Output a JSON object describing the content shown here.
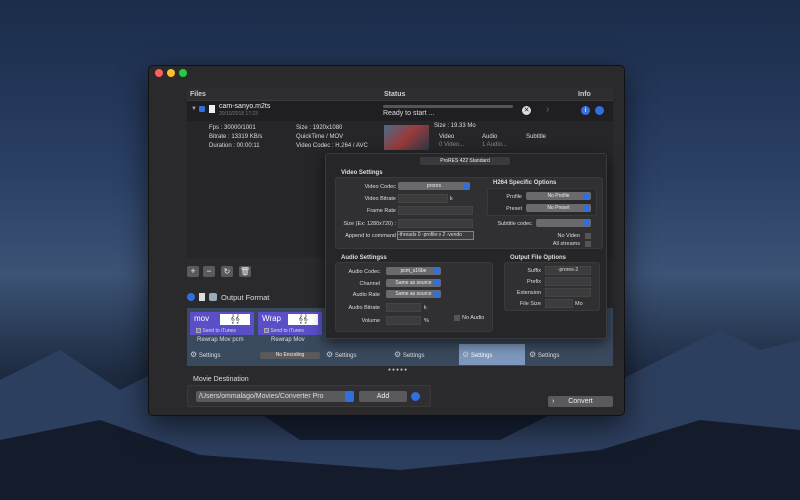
{
  "window": {
    "close_color": "#fe5f57",
    "min_color": "#febc2e",
    "max_color": "#28c840"
  },
  "files_table": {
    "headers": {
      "files": "Files",
      "status": "Status",
      "info": "Info"
    },
    "file": {
      "name": "cam-sanyo.m2ts",
      "date": "20/10/2018 17:23",
      "status": "Ready to start ...",
      "progress": 0,
      "fps": "Fps : 30000/1001",
      "bitrate": "Bitrate : 13319 KB/s",
      "duration": "Duration : 00:00:11",
      "size": "Size : 1920x1080",
      "container": "QuickTime / MOV",
      "video_codec": "Video Codec : H.264 / AVC",
      "file_size": "Size : 19.33 Mo",
      "video_label": "Video",
      "video_value": "0 Video...",
      "audio_label": "Audio",
      "audio_value": "1 Audio...",
      "subtitle_label": "Subtitle"
    }
  },
  "popover": {
    "preset": "ProRES 422 Standard",
    "video": {
      "title": "Video Settings",
      "codec_label": "Video Codec",
      "codec": "prores",
      "bitrate_label": "Video Bitrate",
      "bitrate_unit": "k",
      "framerate_label": "Frame Rate",
      "size_label": "Size (Ex: 1280x720) :",
      "append_label": "Append to command",
      "append_value": "-threads 0 -profile:v 2 -vendo"
    },
    "h264": {
      "title": "H264 Specific Options",
      "profile_label": "Profile",
      "profile": "No Profile",
      "preset_label": "Preset",
      "preset": "No Preset"
    },
    "subtitle_codec_label": "Subtitle codec",
    "no_video": "No Video",
    "all_streams": "All streams",
    "audio": {
      "title": "Audio Settingss",
      "codec_label": "Audio Codec",
      "codec": "pcm_s16be",
      "channel_label": "Channel",
      "channel": "Same as source",
      "rate_label": "Audio Rate",
      "rate": "Same as source",
      "bitrate_label": "Audio Bitrate",
      "bitrate_unit": "k",
      "volume_label": "Volume",
      "volume_unit": "%",
      "no_audio": "No Audio"
    },
    "output": {
      "title": "Output File Options",
      "suffix_label": "Suffix",
      "suffix": "-prores-2",
      "prefix_label": "Prefix",
      "extension_label": "Extension",
      "filesize_label": "File Size",
      "filesize_unit": "Mo"
    }
  },
  "output_format": {
    "title": "Output Format",
    "cards": [
      {
        "tag": "mov",
        "itunes": "Send to iTunes",
        "name": "Rewrap Mov pcm"
      },
      {
        "tag": "Wrap",
        "itunes": "Send to iTunes",
        "name": "Rewrap Mov",
        "badge": "No Encoding"
      }
    ],
    "settings_label": "Settings"
  },
  "destination": {
    "title": "Movie Destination",
    "path": "/Users/ommalago/Movies/Converter Pro",
    "add": "Add"
  },
  "convert": "Convert"
}
